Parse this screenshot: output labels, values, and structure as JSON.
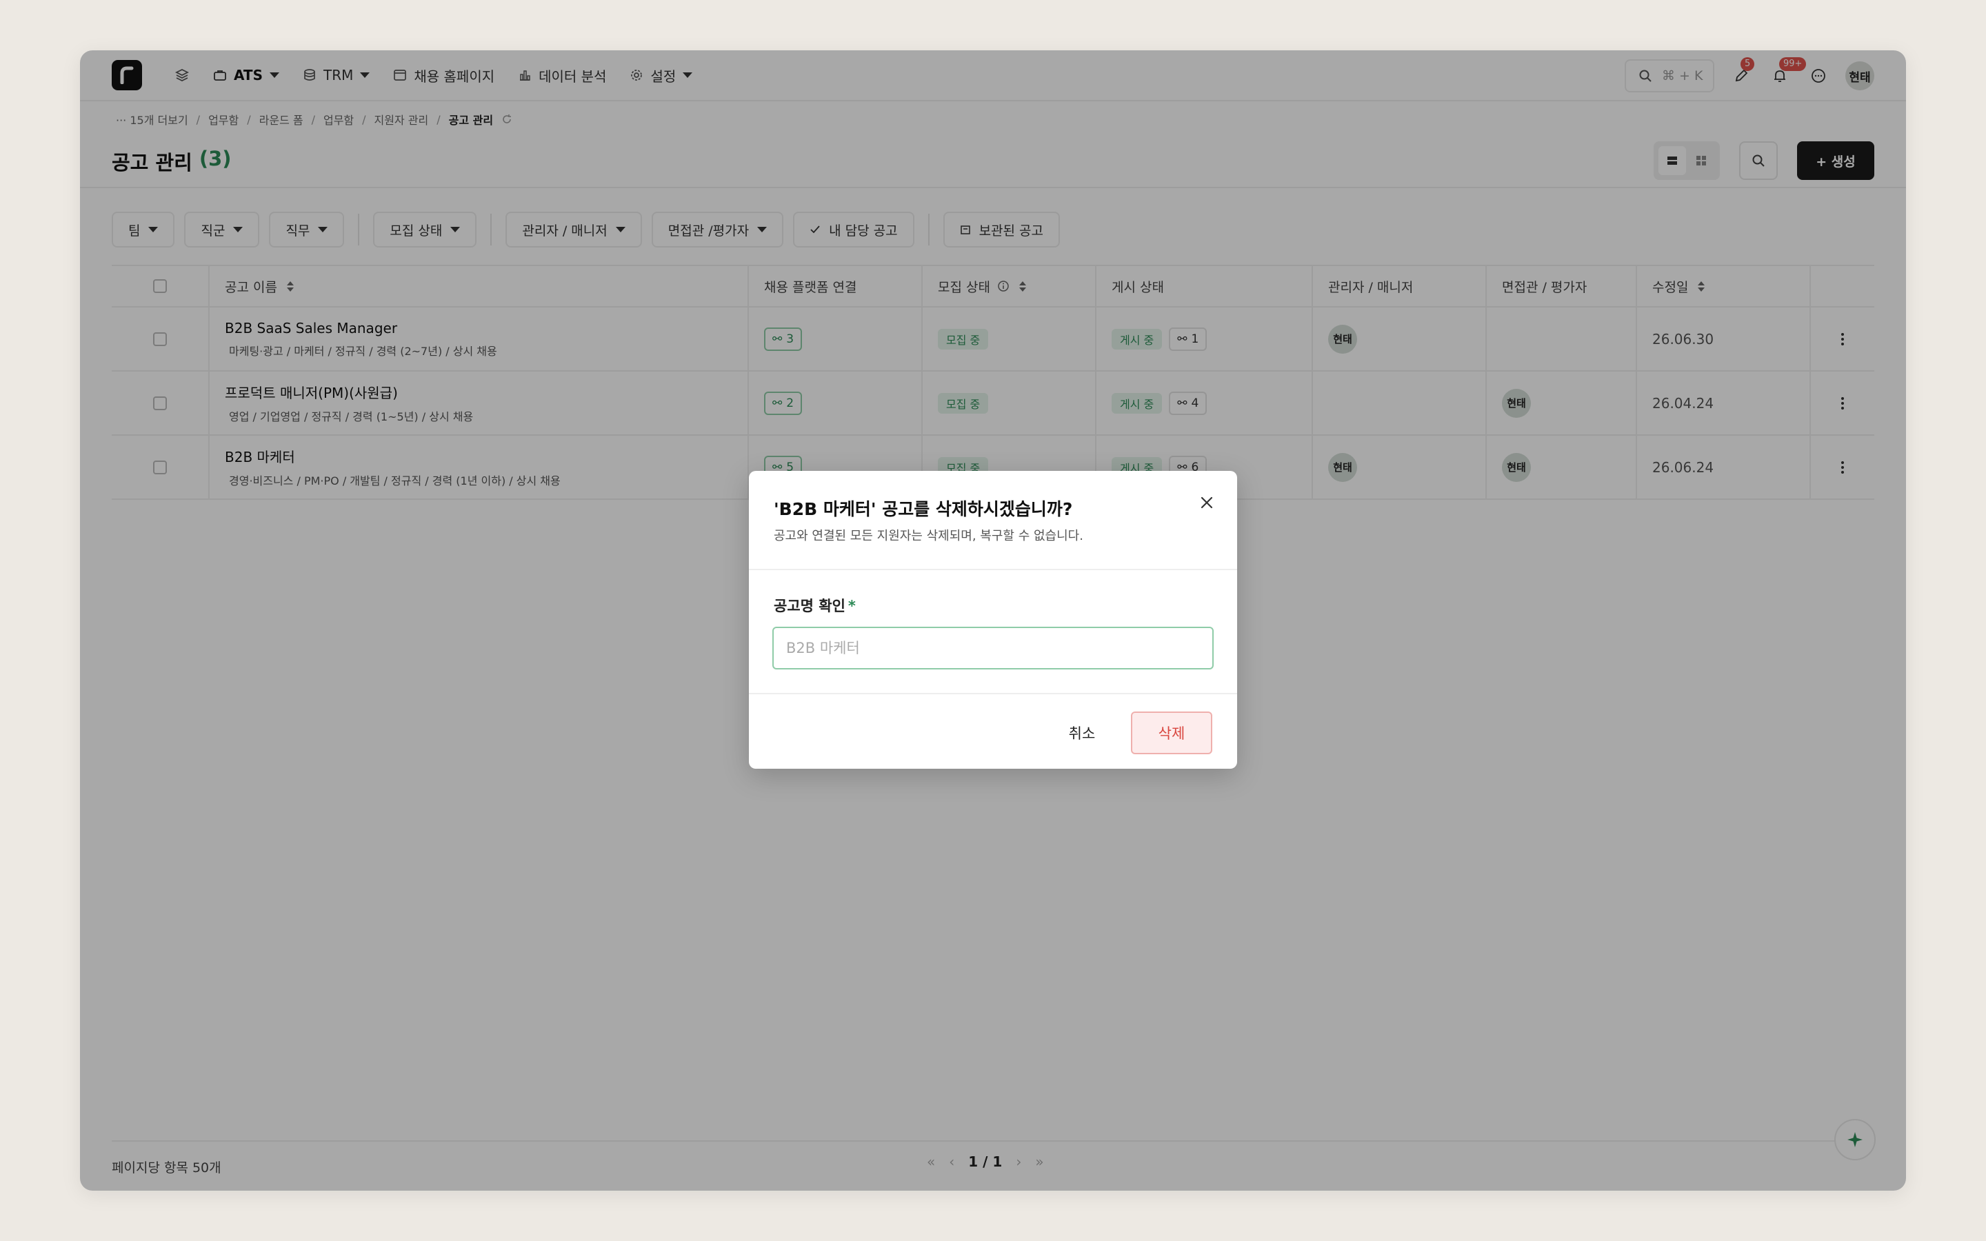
{
  "nav": {
    "items": [
      {
        "label": "ATS"
      },
      {
        "label": "TRM"
      },
      {
        "label": "채용 홈페이지"
      },
      {
        "label": "데이터 분석"
      },
      {
        "label": "설정"
      }
    ],
    "search_shortcut": "⌘ + K",
    "edit_badge": "5",
    "notif_badge": "99+",
    "user_avatar": "현태"
  },
  "breadcrumb": {
    "more": "··· 15개 더보기",
    "items": [
      "업무함",
      "라운드 폼",
      "업무함",
      "지원자 관리"
    ],
    "current": "공고 관리"
  },
  "page": {
    "title": "공고 관리",
    "count": "(3)",
    "create_label": "+ 생성"
  },
  "filters": {
    "team": "팀",
    "job_group": "직군",
    "job": "직무",
    "status": "모집 상태",
    "manager": "관리자 / 매니저",
    "interviewer": "면접관 /평가자",
    "mine": "내 담당 공고",
    "archived": "보관된 공고"
  },
  "table": {
    "headers": {
      "name": "공고 이름",
      "platform": "채용 플랫폼 연결",
      "recruit_status": "모집 상태",
      "post_status": "게시 상태",
      "manager": "관리자 / 매니저",
      "interviewer": "면접관 / 평가자",
      "modified": "수정일"
    },
    "rows": [
      {
        "name": "B2B SaaS Sales Manager",
        "meta": "마케팅·광고 / 마케터 / 정규직 / 경력 (2~7년) / 상시 채용",
        "platform": "3",
        "recruit_status": "모집 중",
        "post_status": "게시 중",
        "post_links": "1",
        "manager": "현태",
        "interviewer": "",
        "modified": "26.06.30"
      },
      {
        "name": "프로덕트 매니저(PM)(사원급)",
        "meta": "영업 / 기업영업 / 정규직 / 경력 (1~5년) / 상시 채용",
        "platform": "2",
        "recruit_status": "모집 중",
        "post_status": "게시 중",
        "post_links": "4",
        "manager": "",
        "interviewer": "현태",
        "modified": "26.04.24"
      },
      {
        "name": "B2B 마케터",
        "meta": "경영·비즈니스 / PM·PO / 개발팀 / 정규직 / 경력 (1년 이하) / 상시 채용",
        "platform": "5",
        "recruit_status": "모집 중",
        "post_status": "게시 중",
        "post_links": "6",
        "manager": "현태",
        "interviewer": "현태",
        "modified": "26.06.24"
      }
    ]
  },
  "footer": {
    "per_page": "페이지당 항목 50개",
    "page": "1 / 1"
  },
  "modal": {
    "title": "'B2B 마케터' 공고를 삭제하시겠습니까?",
    "description": "공고와 연결된 모든 지원자는 삭제되며, 복구할 수 없습니다.",
    "field_label": "공고명 확인",
    "required_mark": "*",
    "input_placeholder": "B2B 마케터",
    "input_value": "",
    "cancel_label": "취소",
    "delete_label": "삭제"
  },
  "colors": {
    "accent_green": "#2d8a57",
    "danger_red": "#d9463f",
    "dark_button": "#1a1a1a"
  }
}
